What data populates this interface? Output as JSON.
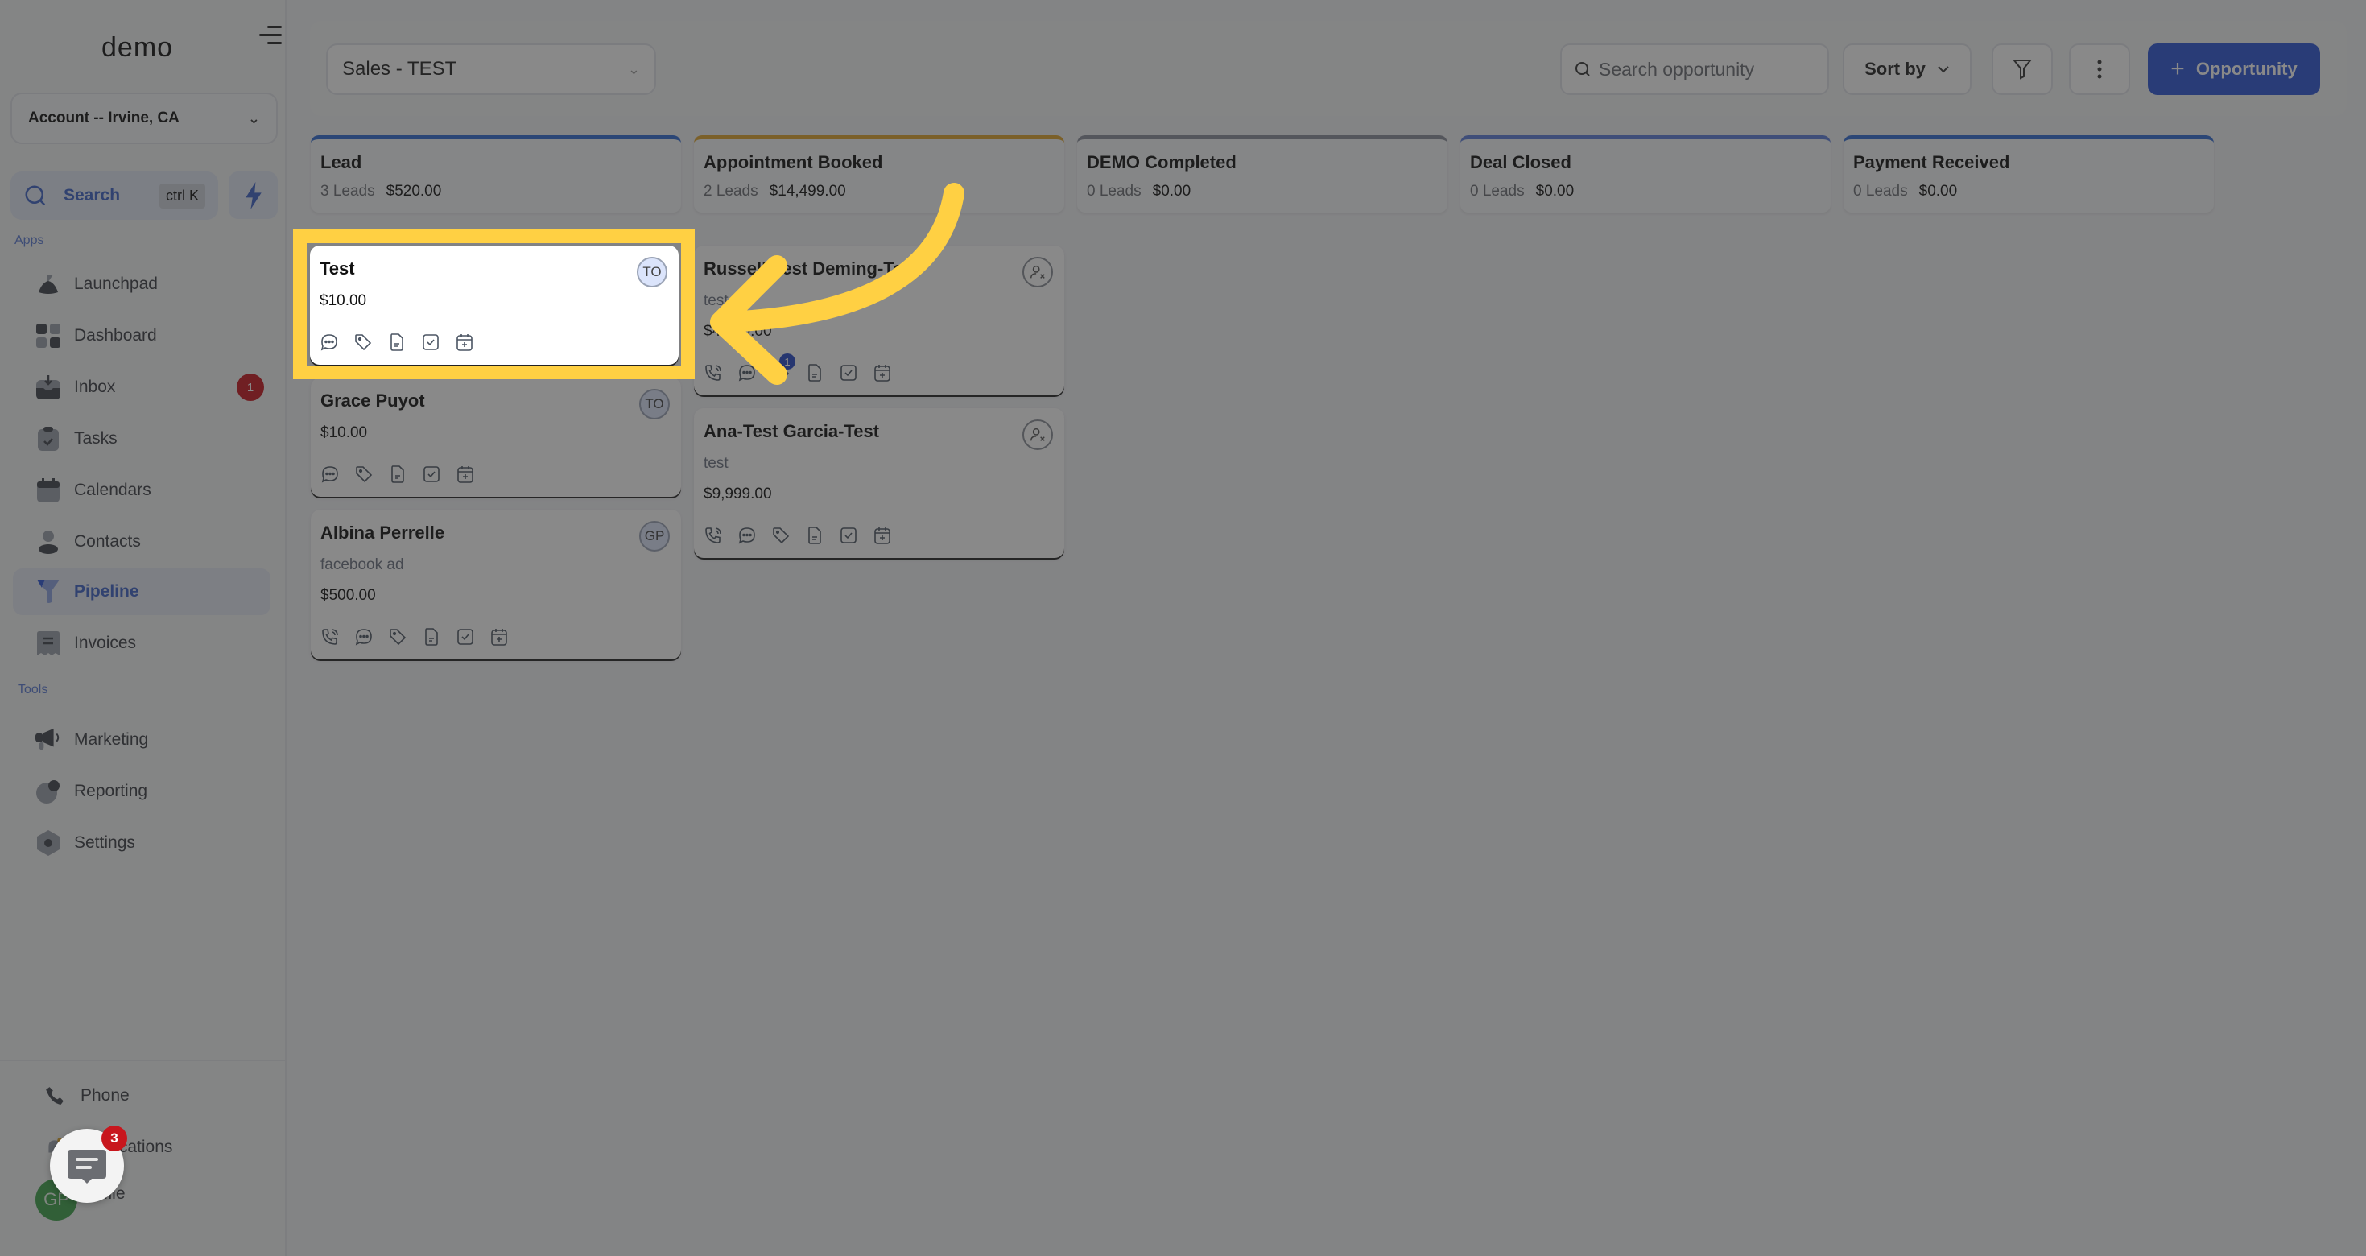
{
  "sidebar": {
    "logo": "demo",
    "account": "Account -- Irvine, CA",
    "search_label": "Search",
    "search_shortcut": "ctrl K",
    "apps_label": "Apps",
    "tools_label": "Tools",
    "apps": [
      {
        "label": "Launchpad",
        "icon": "rocket-icon"
      },
      {
        "label": "Dashboard",
        "icon": "dashboard-icon"
      },
      {
        "label": "Inbox",
        "icon": "inbox-icon",
        "badge": "1"
      },
      {
        "label": "Tasks",
        "icon": "clipboard-check-icon"
      },
      {
        "label": "Calendars",
        "icon": "calendar-icon"
      },
      {
        "label": "Contacts",
        "icon": "user-icon"
      },
      {
        "label": "Pipeline",
        "icon": "funnel-icon",
        "active": true
      },
      {
        "label": "Invoices",
        "icon": "receipt-icon"
      }
    ],
    "tools": [
      {
        "label": "Marketing",
        "icon": "megaphone-icon"
      },
      {
        "label": "Reporting",
        "icon": "pie-chart-icon"
      },
      {
        "label": "Settings",
        "icon": "gear-icon"
      }
    ],
    "bottom": [
      {
        "label": "Phone",
        "icon": "phone-icon"
      },
      {
        "label": "Notifications",
        "icon": "bell-icon"
      },
      {
        "label": "Profile",
        "icon": "avatar"
      }
    ],
    "profile_initials": "GP",
    "chat_badge": "3"
  },
  "header": {
    "pipeline": "Sales - TEST",
    "search_placeholder": "Search opportunity",
    "sort_label": "Sort by",
    "add_label": "Opportunity"
  },
  "columns": [
    {
      "title": "Lead",
      "count": "3 Leads",
      "amount": "$520.00",
      "color": "#2f6bd6",
      "cards": [
        {
          "name": "Test",
          "value": "$10.00",
          "avatar": "TO",
          "highlighted": true
        },
        {
          "name": "Grace Puyot",
          "value": "$10.00",
          "avatar": "TO"
        },
        {
          "name": "Albina Perrelle",
          "desc": "facebook ad",
          "value": "$500.00",
          "avatar": "GP"
        }
      ]
    },
    {
      "title": "Appointment Booked",
      "count": "2 Leads",
      "amount": "$14,499.00",
      "color": "#e0a52b",
      "cards": [
        {
          "name": "Russell-Test Deming-Test",
          "desc": "test",
          "value": "$4,500.00",
          "avatar": "unassigned",
          "tag_badge": "1"
        },
        {
          "name": "Ana-Test Garcia-Test",
          "desc": "test",
          "value": "$9,999.00",
          "avatar": "unassigned"
        }
      ]
    },
    {
      "title": "DEMO Completed",
      "count": "0 Leads",
      "amount": "$0.00",
      "color": "#8a8f9c",
      "cards": []
    },
    {
      "title": "Deal Closed",
      "count": "0 Leads",
      "amount": "$0.00",
      "color": "#5b7ddc",
      "cards": []
    },
    {
      "title": "Payment Received",
      "count": "0 Leads",
      "amount": "$0.00",
      "color": "#2f6bd6",
      "cards": []
    }
  ],
  "colors": {
    "accent": "#2b55d8",
    "highlight": "#ffd043",
    "badge": "#c8161d"
  }
}
